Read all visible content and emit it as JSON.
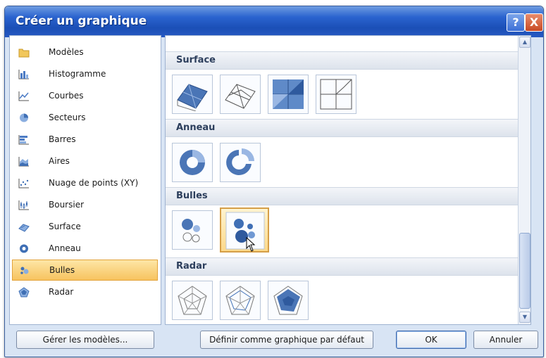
{
  "window": {
    "title": "Créer un graphique"
  },
  "title_buttons": {
    "help": "?",
    "close": "X"
  },
  "categories": [
    {
      "label": "Modèles",
      "icon": "folder-icon"
    },
    {
      "label": "Histogramme",
      "icon": "column-chart-icon"
    },
    {
      "label": "Courbes",
      "icon": "line-chart-icon"
    },
    {
      "label": "Secteurs",
      "icon": "pie-chart-icon"
    },
    {
      "label": "Barres",
      "icon": "bar-chart-icon"
    },
    {
      "label": "Aires",
      "icon": "area-chart-icon"
    },
    {
      "label": "Nuage de points (XY)",
      "icon": "scatter-chart-icon"
    },
    {
      "label": "Boursier",
      "icon": "stock-chart-icon"
    },
    {
      "label": "Surface",
      "icon": "surface-chart-icon"
    },
    {
      "label": "Anneau",
      "icon": "doughnut-chart-icon"
    },
    {
      "label": "Bulles",
      "icon": "bubble-chart-icon",
      "selected": true
    },
    {
      "label": "Radar",
      "icon": "radar-chart-icon"
    }
  ],
  "sections": [
    {
      "title": "Surface",
      "thumbnails": [
        "3d-surface",
        "wireframe-3d-surface",
        "contour",
        "wireframe-contour"
      ]
    },
    {
      "title": "Anneau",
      "thumbnails": [
        "doughnut",
        "exploded-doughnut"
      ]
    },
    {
      "title": "Bulles",
      "thumbnails": [
        "bubble",
        "3d-bubble"
      ],
      "hovered_index": 1
    },
    {
      "title": "Radar",
      "thumbnails": [
        "radar",
        "radar-with-markers",
        "filled-radar"
      ]
    }
  ],
  "footer": {
    "manage_label": "Gérer les modèles...",
    "default_label": "Définir comme graphique par défaut",
    "ok_label": "OK",
    "cancel_label": "Annuler"
  },
  "colors": {
    "titlebar": "#2a63cf",
    "selection": "#f7c35f",
    "chart_blue": "#3f6fb5"
  }
}
